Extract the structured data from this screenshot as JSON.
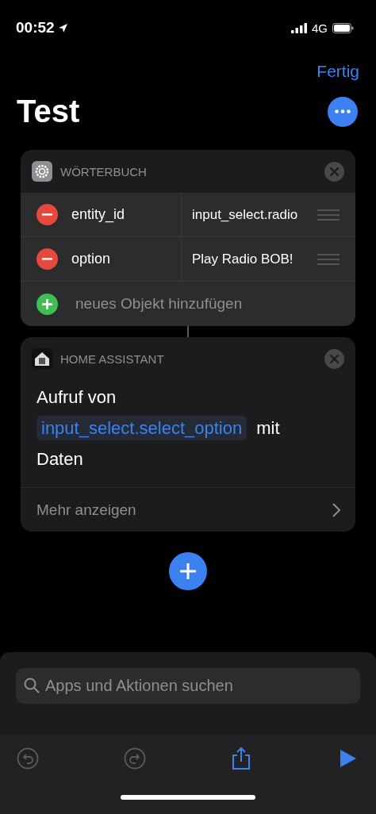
{
  "status_bar": {
    "time": "00:52",
    "network": "4G"
  },
  "nav": {
    "done": "Fertig",
    "title": "Test"
  },
  "dictionary_card": {
    "header": "WÖRTERBUCH",
    "rows": [
      {
        "key": "entity_id",
        "value": "input_select.radio"
      },
      {
        "key": "option",
        "value": "Play Radio BOB!"
      }
    ],
    "add_label": "neues Objekt hinzufügen"
  },
  "action_card": {
    "header": "HOME ASSISTANT",
    "text_before": "Aufruf von",
    "token": "input_select.select_option",
    "text_middle": "mit",
    "text_after": "Daten",
    "more": "Mehr anzeigen"
  },
  "search": {
    "placeholder": "Apps und Aktionen suchen"
  },
  "toolbar": [
    {
      "kind": "undo",
      "disabled": true
    },
    {
      "kind": "redo",
      "disabled": true
    },
    {
      "kind": "share",
      "disabled": false
    },
    {
      "kind": "play",
      "disabled": false
    }
  ]
}
